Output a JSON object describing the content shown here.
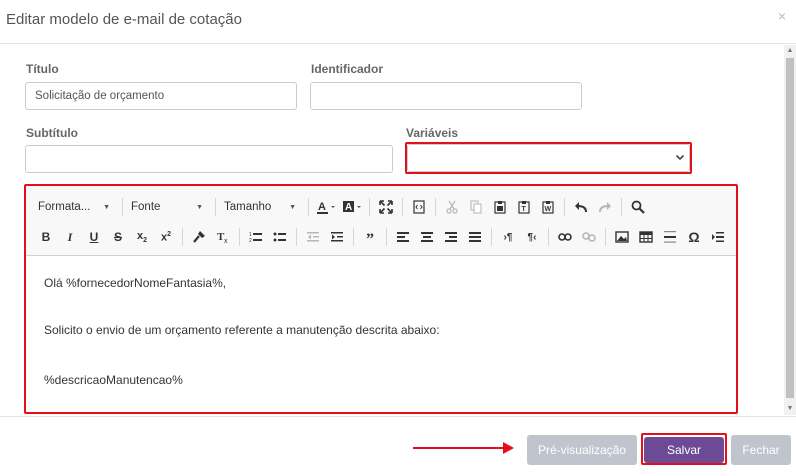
{
  "modal": {
    "title": "Editar modelo de e-mail de cotação",
    "close_glyph": "×"
  },
  "form": {
    "titulo_label": "Título",
    "titulo_value": "Solicitação de orçamento",
    "identificador_label": "Identificador",
    "identificador_value": "",
    "subtitulo_label": "Subtítulo",
    "subtitulo_value": "",
    "variaveis_label": "Variáveis",
    "variaveis_value": ""
  },
  "toolbar": {
    "format_label": "Formata...",
    "font_label": "Fonte",
    "size_label": "Tamanho",
    "row1_icons": [
      "text-color-icon",
      "bg-color-icon",
      "maximize-icon",
      "source-icon",
      "cut-icon",
      "copy-icon",
      "paste-icon",
      "paste-text-icon",
      "paste-word-icon",
      "undo-icon",
      "redo-icon",
      "find-icon"
    ],
    "row2_icons": [
      "bold-icon",
      "italic-icon",
      "underline-icon",
      "strike-icon",
      "subscript-icon",
      "superscript-icon",
      "copy-format-icon",
      "remove-format-icon",
      "numbered-list-icon",
      "bulleted-list-icon",
      "outdent-icon",
      "indent-icon",
      "blockquote-icon",
      "align-left-icon",
      "align-center-icon",
      "align-right-icon",
      "justify-icon",
      "ltr-icon",
      "rtl-icon",
      "link-icon",
      "unlink-icon",
      "image-icon",
      "table-icon",
      "horizontal-line-icon",
      "special-char-icon",
      "page-break-icon"
    ]
  },
  "editor": {
    "line1": "Olá %fornecedorNomeFantasia%,",
    "line2": "Solicito o envio de um orçamento referente a manutenção descrita abaixo:",
    "line3": "%descricaoManutencao%"
  },
  "footer": {
    "preview_label": "Pré-visualização",
    "save_label": "Salvar",
    "close_label": "Fechar"
  },
  "colors": {
    "accent": "#6c4a95",
    "highlight": "#e3101b",
    "disabled": "#c0c4cc"
  }
}
